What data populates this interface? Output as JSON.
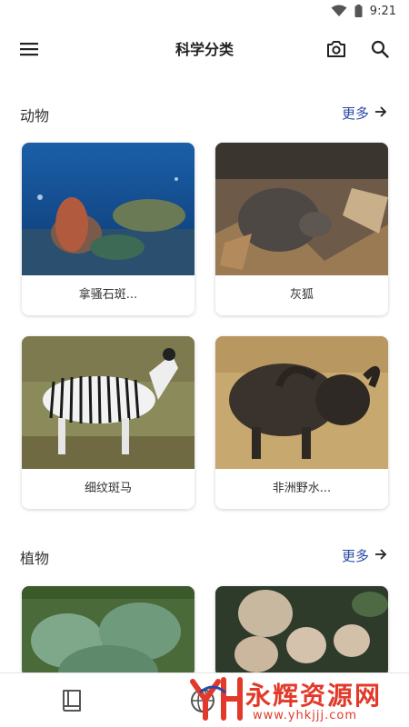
{
  "status_bar": {
    "time": "9:21",
    "icons": [
      "wifi-icon",
      "battery-icon"
    ]
  },
  "app_bar": {
    "title": "科学分类",
    "icons": [
      "menu-icon",
      "camera-icon",
      "search-icon"
    ]
  },
  "sections": [
    {
      "title": "动物",
      "more_label": "更多",
      "cards": [
        {
          "label": "拿骚石斑..."
        },
        {
          "label": "灰狐"
        },
        {
          "label": "细纹斑马"
        },
        {
          "label": "非洲野水..."
        }
      ]
    },
    {
      "title": "植物",
      "more_label": "更多",
      "cards": [
        {
          "label": ""
        },
        {
          "label": ""
        }
      ]
    }
  ],
  "bottom_nav": {
    "icons": [
      "book-icon",
      "globe-icon"
    ]
  },
  "watermark": {
    "main": "永辉资源网",
    "sub": "www.yhkjjj.com"
  },
  "colors": {
    "accent": "#2a4aa6",
    "watermark": "#e23a2a"
  }
}
